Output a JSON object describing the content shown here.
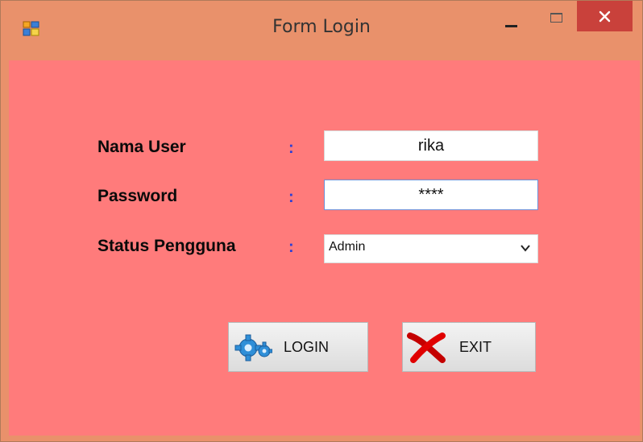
{
  "window": {
    "title": "Form Login",
    "controls": {
      "minimize": "minimize",
      "maximize": "maximize",
      "close": "close"
    }
  },
  "form": {
    "username": {
      "label": "Nama User",
      "colon": ":",
      "value": "rika"
    },
    "password": {
      "label": "Password",
      "colon": ":",
      "value": "****"
    },
    "status": {
      "label": "Status Pengguna",
      "colon": ":",
      "value": "Admin"
    }
  },
  "buttons": {
    "login": {
      "label": "LOGIN",
      "icon": "gear-icon"
    },
    "exit": {
      "label": "EXIT",
      "icon": "red-x-icon"
    }
  },
  "colors": {
    "titlebar": "#e9916b",
    "client_bg": "#ff7b7b",
    "close_button": "#c9413b",
    "colon": "#2a3fd6"
  }
}
